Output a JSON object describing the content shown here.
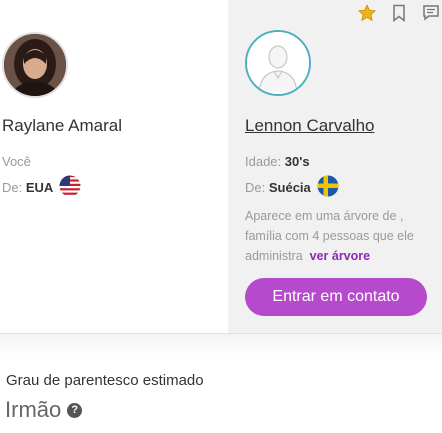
{
  "colors": {
    "accent": "#b54bcc",
    "link": "#8d2ab2",
    "star": "#f2b21b",
    "avatar_ring": "#4fb1c0",
    "right_panel_bg": "#f1f1f1"
  },
  "top_icons": [
    "star-icon",
    "bookmark-icon",
    "message-icon"
  ],
  "user": {
    "name": "Raylane Amaral",
    "you_label": "Você",
    "from_label": "De:",
    "country": "EUA",
    "flag": "us-flag-icon"
  },
  "match": {
    "name": "Lennon Carvalho",
    "age_label": "Idade:",
    "age": "30's",
    "from_label": "De:",
    "country": "Suécia",
    "flag": "sweden-flag-icon",
    "tree_text": "Aparece em uma árvore de , família com 4 pessoas que ele administra",
    "tree_link": "ver árvore",
    "contact_button": "Entrar em contato"
  },
  "relationship": {
    "label": "Grau de parentesco estimado",
    "value": "Irmão",
    "help_symbol": "?"
  }
}
